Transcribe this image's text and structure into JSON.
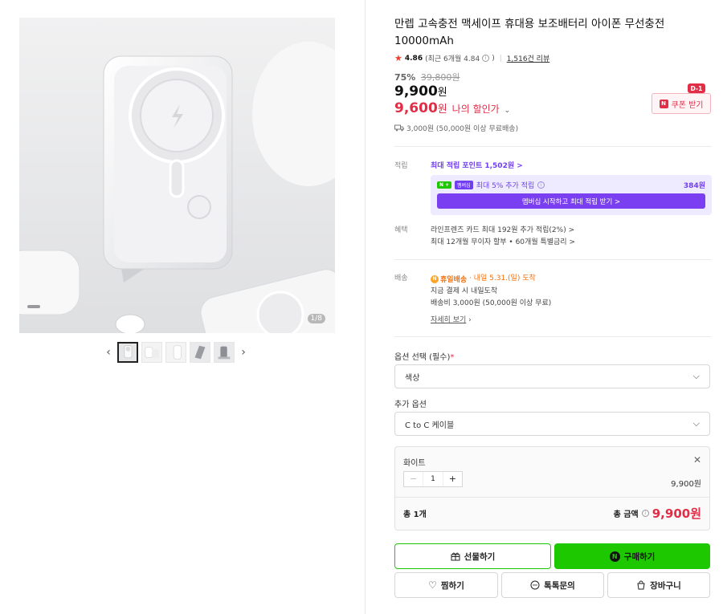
{
  "product": {
    "title": "만렙 고속충전 맥세이프 휴대용 보조배터리 아이폰 무선충전 10000mAh",
    "rating": "4.86",
    "rating_recent": "(최근 6개월 4.84",
    "reviews": "1,516건 리뷰",
    "discount": "75%",
    "original_price": "39,800원",
    "price": "9,900",
    "price_unit": "원",
    "my_price": "9,600",
    "my_price_unit": "원",
    "my_price_label": "나의 할인가",
    "shipping_brief": "3,000원 (50,000원 이상 무료배송)"
  },
  "coupon": {
    "label": "쿠폰 받기",
    "dday": "D-1"
  },
  "points": {
    "label": "적립",
    "max": "최대 적립 포인트 1,502원 >",
    "member_badge": "멤버십",
    "member_text": "최대 5% 추가 적립",
    "member_points": "384원",
    "member_button": "멤버십 시작하고 최대 적립 받기 >"
  },
  "benefits": {
    "label": "혜택",
    "line1": "라인프렌즈 카드 최대 192원 추가 적립(2%) >",
    "line2": "최대 12개월 무이자 할부 • 60개월 특별금리 >"
  },
  "delivery": {
    "label": "배송",
    "badge": "휴일배송",
    "arrival": "· 내일 5.31.(일) 도착",
    "line2": "지금 결제 시 내일도착",
    "line3": "배송비 3,000원 (50,000원 이상 무료)",
    "details": "자세히 보기"
  },
  "options": {
    "required_label": "옵션 선택 (필수)",
    "required_mark": "*",
    "color_select": "색상",
    "extra_label": "추가 옵션",
    "extra_select": "C to C 케이블"
  },
  "selection": {
    "name": "화이트",
    "quantity": "1",
    "item_price": "9,900원",
    "total_count": "총 1개",
    "total_label": "총 금액",
    "total_value": "9,900원"
  },
  "buttons": {
    "gift": "선물하기",
    "buy": "구매하기",
    "wish": "찜하기",
    "talk": "톡톡문의",
    "cart": "장바구니"
  },
  "gallery": {
    "counter": "1/8"
  },
  "icons": {
    "star": "star-icon",
    "truck": "truck-icon",
    "gift": "gift-icon",
    "heart": "heart-icon",
    "chat": "chat-icon",
    "bag": "shopping-bag-icon"
  },
  "colors": {
    "accent_red": "#e22d47",
    "naver_green": "#1ec800",
    "membership_purple": "#6f3ef0"
  }
}
